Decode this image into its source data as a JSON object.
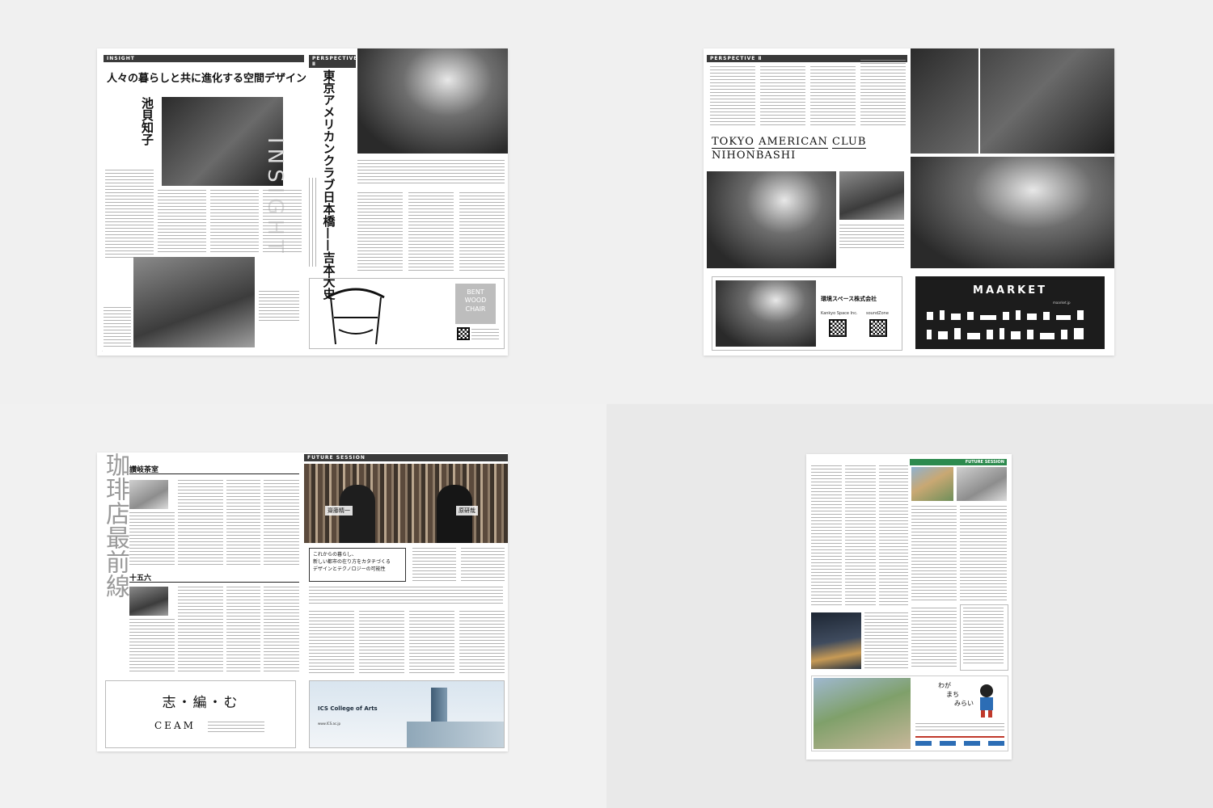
{
  "spread1": {
    "insight_band": "INSIGHT",
    "insight_headline": "人々の暮らしと共に進化する空間デザイン",
    "author_name": "池貝知子",
    "side_watermark": "INSIGHT",
    "perspective_band": "PERSPECTIVE Ⅱ",
    "perspective_title": "東京アメリカンクラブ日本橋",
    "perspective_dash": "——",
    "perspective_person": "吉本大史",
    "chair_ad_line1": "BENT",
    "chair_ad_line2": "WOOD",
    "chair_ad_line3": "CHAIR"
  },
  "spread2": {
    "perspective_band": "PERSPECTIVE Ⅱ",
    "club_name_line1_a": "TOKYO",
    "club_name_line1_b": "AMERICAN",
    "club_name_line1_c": "CLUB",
    "club_name_line2": "NIHONBASHI",
    "ad_company": "環境スペース株式会社",
    "ad_company_sub": "Kankyo Space Inc.",
    "ad_soundzone": "soundZone",
    "maarket_logo": "MAARKET",
    "maarket_url": "maarket.jp"
  },
  "spread3": {
    "series_title": "珈琲店最前線",
    "shop1": "讃岐茶室",
    "shop2": "十五六",
    "future_band": "FUTURE SESSION",
    "person_left": "齋藤精一",
    "person_right": "原研哉",
    "session_heading_1": "これからの暮らし、",
    "session_heading_2": "新しい都市の在り方をカタチづくる",
    "session_heading_3": "デザインとテクノロジーの可能性",
    "ceam_jp": "志・編・む",
    "ceam_en": "CEAM",
    "ics_name": "ICS College of Arts",
    "ics_url": "www.ICS.ac.jp"
  },
  "spread4": {
    "future_band": "FUTURE SESSION",
    "ad_slogan_1": "わが",
    "ad_slogan_2": "まち",
    "ad_slogan_3": "みらい"
  }
}
